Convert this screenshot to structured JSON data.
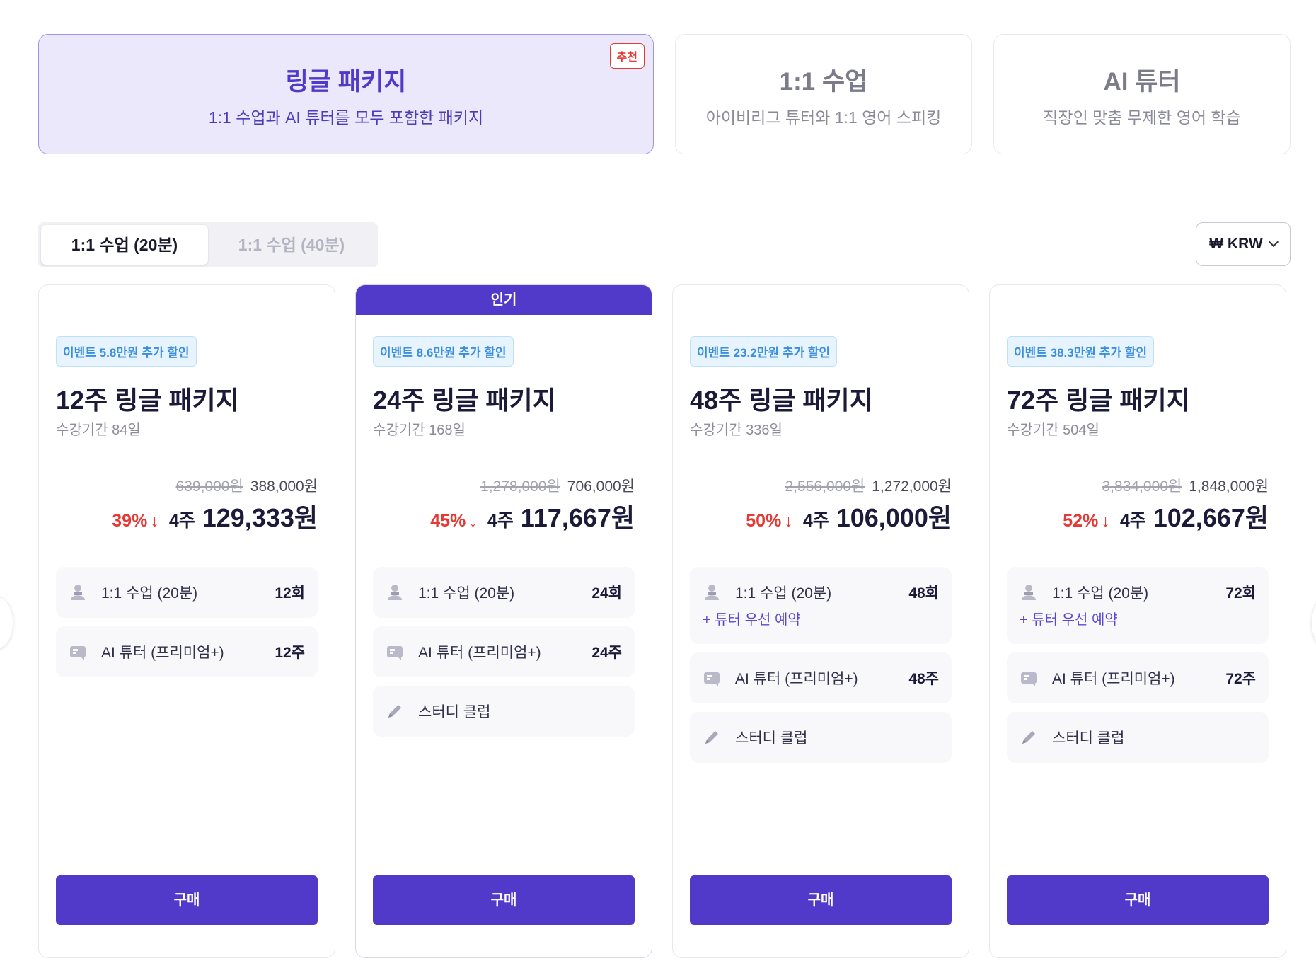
{
  "product_tabs": [
    {
      "title": "링글 패키지",
      "subtitle": "1:1 수업과 AI 튜터를 모두 포함한 패키지",
      "badge": "추천"
    },
    {
      "title": "1:1 수업",
      "subtitle": "아이비리그 튜터와 1:1 영어 스피킹"
    },
    {
      "title": "AI 튜터",
      "subtitle": "직장인 맞춤 무제한 영어 학습"
    }
  ],
  "duration_toggle": {
    "option_20": "1:1 수업 (20분)",
    "option_40": "1:1 수업 (40분)"
  },
  "currency": {
    "label": "₩ KRW"
  },
  "plans": [
    {
      "event_badge": "이벤트 5.8만원 추가 할인",
      "title": "12주 링글 패키지",
      "period": "수강기간 84일",
      "old_price": "639,000원",
      "price": "388,000원",
      "discount": "39%",
      "weeks_label": "4주",
      "weekly_price": "129,333원",
      "features": [
        {
          "label": "1:1 수업 (20분)",
          "count": "12회"
        },
        {
          "label": "AI 튜터 (프리미엄+)",
          "count": "12주"
        }
      ],
      "buy_label": "구매"
    },
    {
      "popular_banner": "인기",
      "event_badge": "이벤트 8.6만원 추가 할인",
      "title": "24주 링글 패키지",
      "period": "수강기간 168일",
      "old_price": "1,278,000원",
      "price": "706,000원",
      "discount": "45%",
      "weeks_label": "4주",
      "weekly_price": "117,667원",
      "features": [
        {
          "label": "1:1 수업 (20분)",
          "count": "24회"
        },
        {
          "label": "AI 튜터 (프리미엄+)",
          "count": "24주"
        },
        {
          "label": "스터디 클럽",
          "count": ""
        }
      ],
      "buy_label": "구매"
    },
    {
      "event_badge": "이벤트 23.2만원 추가 할인",
      "title": "48주 링글 패키지",
      "period": "수강기간 336일",
      "old_price": "2,556,000원",
      "price": "1,272,000원",
      "discount": "50%",
      "weeks_label": "4주",
      "weekly_price": "106,000원",
      "features": [
        {
          "label": "1:1 수업 (20분)",
          "count": "48회",
          "extra": "+ 튜터 우선 예약"
        },
        {
          "label": "AI 튜터 (프리미엄+)",
          "count": "48주"
        },
        {
          "label": "스터디 클럽",
          "count": ""
        }
      ],
      "buy_label": "구매"
    },
    {
      "event_badge": "이벤트 38.3만원 추가 할인",
      "title": "72주 링글 패키지",
      "period": "수강기간 504일",
      "old_price": "3,834,000원",
      "price": "1,848,000원",
      "discount": "52%",
      "weeks_label": "4주",
      "weekly_price": "102,667원",
      "features": [
        {
          "label": "1:1 수업 (20분)",
          "count": "72회",
          "extra": "+ 튜터 우선 예약"
        },
        {
          "label": "AI 튜터 (프리미엄+)",
          "count": "72주"
        },
        {
          "label": "스터디 클럽",
          "count": ""
        }
      ],
      "buy_label": "구매"
    }
  ],
  "icons": {
    "lesson": "person-icon",
    "ai": "chat-card-icon",
    "study": "pencil-icon",
    "arrow_down": "arrow-down-icon"
  },
  "colors": {
    "brand": "#5139c9",
    "discount": "#e53935",
    "event": "#3a8ee0"
  }
}
